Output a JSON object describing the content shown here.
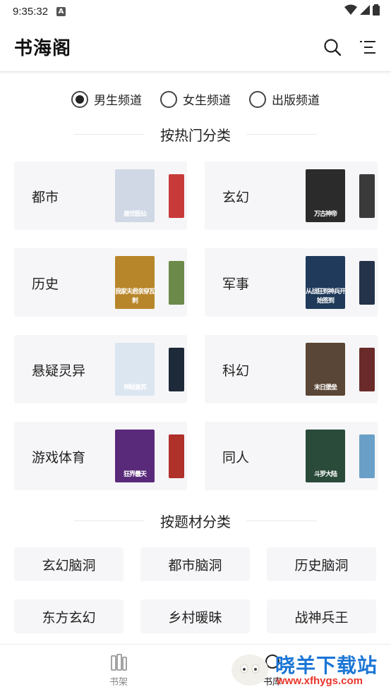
{
  "status_bar": {
    "time": "9:35:32",
    "notification_badge": "A"
  },
  "header": {
    "title": "书海阁",
    "icons": [
      "search-icon",
      "menu-icon"
    ]
  },
  "channels": [
    {
      "label": "男生频道",
      "selected": true
    },
    {
      "label": "女生频道",
      "selected": false
    },
    {
      "label": "出版频道",
      "selected": false
    }
  ],
  "hot_section": {
    "title": "按热门分类"
  },
  "categories": [
    {
      "name": "都市",
      "cover_text": "盖世医仙",
      "cover_color": "#cfd8e4",
      "back_color": "#c83a3a"
    },
    {
      "name": "玄幻",
      "cover_text": "万古神帝",
      "cover_color": "#2b2b2b",
      "back_color": "#3a3a3a"
    },
    {
      "name": "历史",
      "cover_text": "我家夫君亲穿瓦剌",
      "cover_color": "#b8862a",
      "back_color": "#6c8a4a"
    },
    {
      "name": "军事",
      "cover_text": "从战狂到神兵开始签到",
      "cover_color": "#1f3a5a",
      "back_color": "#24334a"
    },
    {
      "name": "悬疑灵异",
      "cover_text": "神秘复苏",
      "cover_color": "#dce6f0",
      "back_color": "#1e2a3a"
    },
    {
      "name": "科幻",
      "cover_text": "末日堡垒",
      "cover_color": "#5a4636",
      "back_color": "#6a2a2a"
    },
    {
      "name": "游戏体育",
      "cover_text": "狂界曇天",
      "cover_color": "#5a2a7a",
      "back_color": "#b0302a"
    },
    {
      "name": "同人",
      "cover_text": "斗罗大陆",
      "cover_color": "#2a4a3a",
      "back_color": "#6aa0c8"
    }
  ],
  "theme_section": {
    "title": "按题材分类"
  },
  "tags": [
    "玄幻脑洞",
    "都市脑洞",
    "历史脑洞",
    "东方玄幻",
    "乡村暖昧",
    "战神兵王"
  ],
  "bottom_nav": {
    "shelf_label": "书架",
    "library_label": "书库"
  },
  "watermark": {
    "text": "晓羊下载站",
    "url": "www.xfhygs.com"
  }
}
